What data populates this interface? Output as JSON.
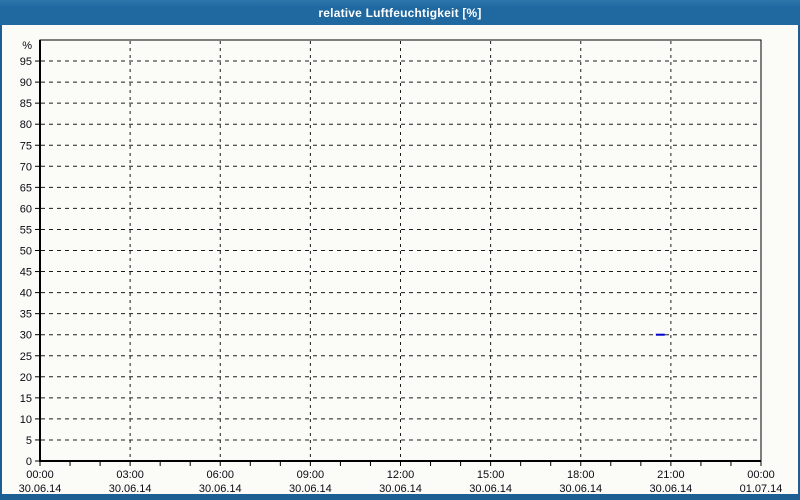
{
  "window": {
    "title": "relative Luftfeuchtigkeit [%]",
    "colors": {
      "titlebar": "#1f68a0",
      "titlebar_highlight": "#2d77ad",
      "border": "#1d5f92",
      "background": "#fbfbf7",
      "axis": "#000000",
      "grid": "#1c1c1c",
      "label": "#0a0a14"
    }
  },
  "chart_data": {
    "type": "line",
    "title": "relative Luftfeuchtigkeit [%]",
    "ylabel": "%",
    "ylim": [
      0,
      100
    ],
    "y_ticks": [
      0,
      5,
      10,
      15,
      20,
      25,
      30,
      35,
      40,
      45,
      50,
      55,
      60,
      65,
      70,
      75,
      80,
      85,
      90,
      95
    ],
    "grid": {
      "horizontal_every": 5,
      "vertical_every_hours": 3,
      "style": "dashed"
    },
    "x_axis": {
      "range_hours": [
        0,
        24
      ],
      "minor_tick_every_hours": 1,
      "major_ticks": [
        {
          "hour": 0,
          "time": "00:00",
          "date": "30.06.14"
        },
        {
          "hour": 3,
          "time": "03:00",
          "date": "30.06.14"
        },
        {
          "hour": 6,
          "time": "06:00",
          "date": "30.06.14"
        },
        {
          "hour": 9,
          "time": "09:00",
          "date": "30.06.14"
        },
        {
          "hour": 12,
          "time": "12:00",
          "date": "30.06.14"
        },
        {
          "hour": 15,
          "time": "15:00",
          "date": "30.06.14"
        },
        {
          "hour": 18,
          "time": "18:00",
          "date": "30.06.14"
        },
        {
          "hour": 21,
          "time": "21:00",
          "date": "30.06.14"
        },
        {
          "hour": 24,
          "time": "00:00",
          "date": "01.07.14"
        }
      ]
    },
    "legend": "none",
    "series": [
      {
        "name": "relative Luftfeuchtigkeit",
        "color": "#0000cc",
        "points": [
          {
            "hour": 20.5,
            "value": 30
          },
          {
            "hour": 20.8,
            "value": 30
          }
        ]
      }
    ]
  }
}
